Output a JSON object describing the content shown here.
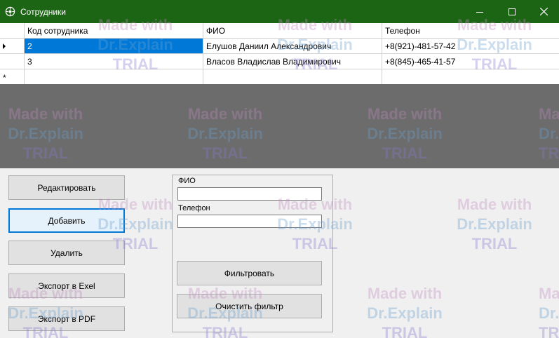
{
  "window": {
    "title": "Сотрудники",
    "accent_color": "#1c6514"
  },
  "grid": {
    "columns": [
      "Код сотрудника",
      "ФИО",
      "Телефон"
    ],
    "rows": [
      {
        "code": "2",
        "name": "Елушов Даниил Александрович",
        "phone": "+8(921)-481-57-42",
        "selected": true
      },
      {
        "code": "3",
        "name": "Власов Владислав Владимирович",
        "phone": "+8(845)-465-41-57",
        "selected": false
      }
    ],
    "new_row_marker": "*"
  },
  "actions": {
    "edit": "Редактировать",
    "add": "Добавить",
    "delete": "Удалить",
    "export_excel": "Экспорт в Exel",
    "export_pdf": "Экспорт в PDF"
  },
  "filter": {
    "name_label": "ФИО",
    "name_value": "",
    "phone_label": "Телефон",
    "phone_value": "",
    "apply": "Фильтровать",
    "clear": "Очистить фильтр"
  },
  "watermark": {
    "line1": "Made with",
    "line2": "Dr.Explain",
    "line3": "TRIAL"
  }
}
